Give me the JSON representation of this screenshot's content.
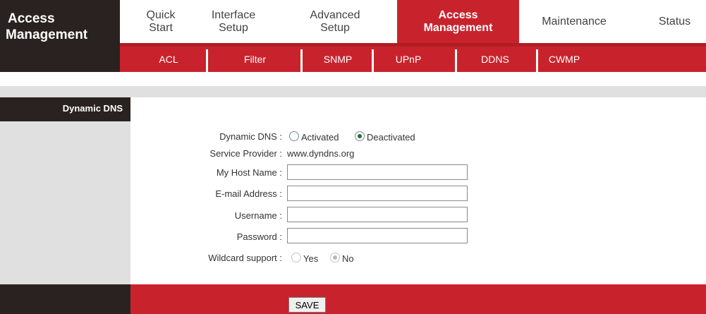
{
  "brand": {
    "line1": "Access",
    "line2": "Management"
  },
  "top_tabs": [
    {
      "line1": "Quick",
      "line2": "Start"
    },
    {
      "line1": "Interface",
      "line2": "Setup"
    },
    {
      "line1": "Advanced",
      "line2": "Setup"
    },
    {
      "line1": "Access",
      "line2": "Management",
      "active": true
    },
    {
      "line1": "Maintenance",
      "line2": ""
    },
    {
      "line1": "Status",
      "line2": ""
    }
  ],
  "sub_tabs": [
    "ACL",
    "Filter",
    "SNMP",
    "UPnP",
    "DDNS",
    "CWMP"
  ],
  "section": {
    "title": "Dynamic DNS"
  },
  "form": {
    "ddns_label": "Dynamic DNS :",
    "ddns_opt_activated": "Activated",
    "ddns_opt_deactivated": "Deactivated",
    "ddns_selected": "Deactivated",
    "provider_label": "Service Provider :",
    "provider_value": "www.dyndns.org",
    "hostname_label": "My Host Name :",
    "hostname_value": "",
    "email_label": "E-mail Address :",
    "email_value": "",
    "username_label": "Username :",
    "username_value": "",
    "password_label": "Password :",
    "password_value": "",
    "wildcard_label": "Wildcard support :",
    "wildcard_yes": "Yes",
    "wildcard_no": "No",
    "wildcard_selected": "No"
  },
  "footer": {
    "save_label": "SAVE"
  },
  "colors": {
    "brand_dark": "#2a2220",
    "accent_red": "#c8232c",
    "panel_gray": "#e0e0e0"
  }
}
